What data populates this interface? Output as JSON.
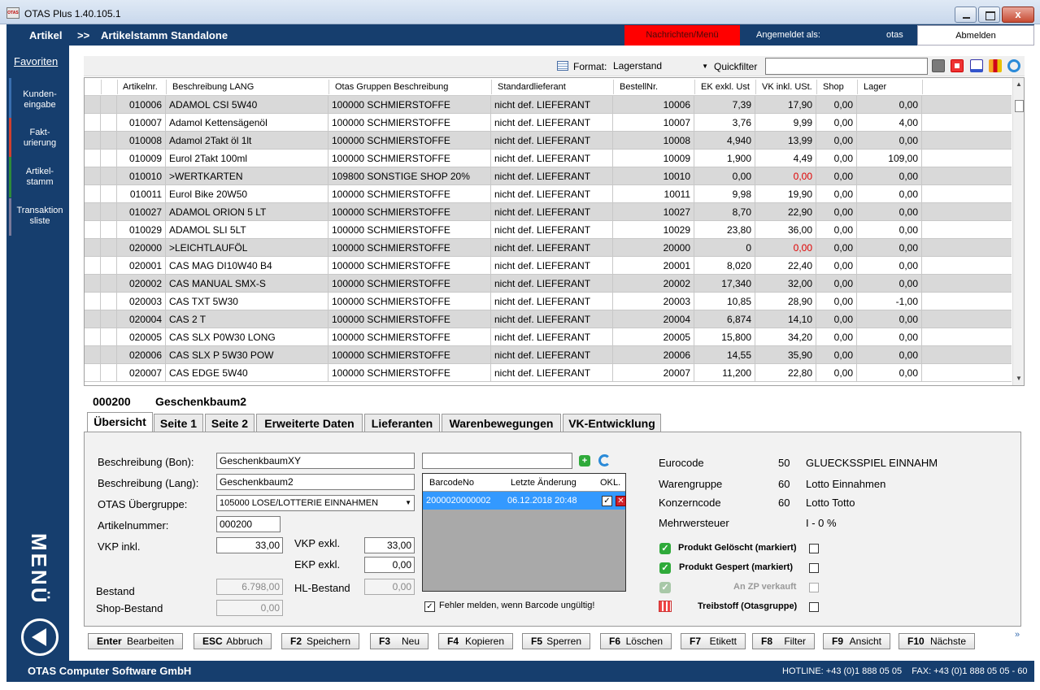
{
  "window": {
    "title": "OTAS Plus 1.40.105.1",
    "close_label": "x"
  },
  "header": {
    "section": "Artikel",
    "separator": ">>",
    "subtitle": "Artikelstamm Standalone",
    "messages": "Nachrichten/Menü",
    "logged_in_label": "Angemeldet als:",
    "user": "otas",
    "logout": "Abmelden"
  },
  "sidebar": {
    "favorites": "Favoriten",
    "items": [
      {
        "label": "Kunden-\neingabe",
        "color": "#3a6fb0"
      },
      {
        "label": "Fakt-\nurierung",
        "color": "#d04030"
      },
      {
        "label": "Artikel-\nstamm",
        "color": "#2e8b3a"
      },
      {
        "label": "Transaktion\nsliste",
        "color": "#7a7a9a"
      }
    ],
    "menu_label": "MENÜ"
  },
  "toolbar": {
    "format_label": "Format:",
    "format_value": "Lagerstand",
    "quickfilter_label": "Quickfilter",
    "quickfilter_value": ""
  },
  "grid": {
    "columns": [
      "Artikelnr.",
      "Beschreibung LANG",
      "Otas Gruppen Beschreibung",
      "Standardlieferant",
      "BestellNr.",
      "EK exkl. Ust",
      "VK inkl. USt.",
      "Shop",
      "Lager"
    ],
    "rows": [
      [
        "010006",
        "ADAMOL CSI  5W40",
        "100000 SCHMIERSTOFFE",
        "nicht def. LIEFERANT",
        "10006",
        "7,39",
        "17,90",
        "0,00",
        "0,00"
      ],
      [
        "010007",
        "Adamol Kettensägenöl",
        "100000 SCHMIERSTOFFE",
        "nicht def. LIEFERANT",
        "10007",
        "3,76",
        "9,99",
        "0,00",
        "4,00"
      ],
      [
        "010008",
        "Adamol 2Takt öl 1lt",
        "100000 SCHMIERSTOFFE",
        "nicht def. LIEFERANT",
        "10008",
        "4,940",
        "13,99",
        "0,00",
        "0,00"
      ],
      [
        "010009",
        "Eurol 2Takt  100ml",
        "100000 SCHMIERSTOFFE",
        "nicht def. LIEFERANT",
        "10009",
        "1,900",
        "4,49",
        "0,00",
        "109,00"
      ],
      [
        "010010",
        ">WERTKARTEN",
        "109800 SONSTIGE SHOP 20%",
        "nicht def. LIEFERANT",
        "10010",
        "0,00",
        "0,00",
        "0,00",
        "0,00"
      ],
      [
        "010011",
        "Eurol Bike 20W50",
        "100000 SCHMIERSTOFFE",
        "nicht def. LIEFERANT",
        "10011",
        "9,98",
        "19,90",
        "0,00",
        "0,00"
      ],
      [
        "010027",
        "ADAMOL ORION 5 LT",
        "100000 SCHMIERSTOFFE",
        "nicht def. LIEFERANT",
        "10027",
        "8,70",
        "22,90",
        "0,00",
        "0,00"
      ],
      [
        "010029",
        "ADAMOL SLI  5LT",
        "100000 SCHMIERSTOFFE",
        "nicht def. LIEFERANT",
        "10029",
        "23,80",
        "36,00",
        "0,00",
        "0,00"
      ],
      [
        "020000",
        ">LEICHTLAUFÖL",
        "100000 SCHMIERSTOFFE",
        "nicht def. LIEFERANT",
        "20000",
        "0",
        "0,00",
        "0,00",
        "0,00"
      ],
      [
        "020001",
        "CAS MAG DI10W40 B4",
        "100000 SCHMIERSTOFFE",
        "nicht def. LIEFERANT",
        "20001",
        "8,020",
        "22,40",
        "0,00",
        "0,00"
      ],
      [
        "020002",
        "CAS MANUAL SMX-S",
        "100000 SCHMIERSTOFFE",
        "nicht def. LIEFERANT",
        "20002",
        "17,340",
        "32,00",
        "0,00",
        "0,00"
      ],
      [
        "020003",
        "CAS TXT 5W30",
        "100000 SCHMIERSTOFFE",
        "nicht def. LIEFERANT",
        "20003",
        "10,85",
        "28,90",
        "0,00",
        "-1,00"
      ],
      [
        "020004",
        "CAS 2 T",
        "100000 SCHMIERSTOFFE",
        "nicht def. LIEFERANT",
        "20004",
        "6,874",
        "14,10",
        "0,00",
        "0,00"
      ],
      [
        "020005",
        "CAS SLX P0W30 LONG",
        "100000 SCHMIERSTOFFE",
        "nicht def. LIEFERANT",
        "20005",
        "15,800",
        "34,20",
        "0,00",
        "0,00"
      ],
      [
        "020006",
        "CAS SLX P 5W30 POW",
        "100000 SCHMIERSTOFFE",
        "nicht def. LIEFERANT",
        "20006",
        "14,55",
        "35,90",
        "0,00",
        "0,00"
      ],
      [
        "020007",
        "CAS EDGE   5W40",
        "100000 SCHMIERSTOFFE",
        "nicht def. LIEFERANT",
        "20007",
        "11,200",
        "22,80",
        "0,00",
        "0,00"
      ]
    ],
    "red_vk_rows": [
      4,
      8
    ]
  },
  "detail": {
    "code": "000200",
    "name": "Geschenkbaum2",
    "tabs": [
      "Übersicht",
      "Seite 1",
      "Seite 2",
      "Erweiterte Daten",
      "Lieferanten",
      "Warenbewegungen",
      "VK-Entwicklung"
    ],
    "fields": {
      "beschreibung_bon_label": "Beschreibung (Bon):",
      "beschreibung_bon": "GeschenkbaumXY",
      "beschreibung_lang_label": "Beschreibung (Lang):",
      "beschreibung_lang": "Geschenkbaum2",
      "uebergruppe_label": "OTAS Übergruppe:",
      "uebergruppe": "105000 LOSE/LOTTERIE EINNAHMEN",
      "artikelnummer_label": "Artikelnummer:",
      "artikelnummer": "000200",
      "vkp_inkl_label": "VKP inkl.",
      "vkp_inkl": "33,00",
      "vkp_exkl_label": "VKP exkl.",
      "vkp_exkl": "33,00",
      "ekp_exkl_label": "EKP exkl.",
      "ekp_exkl": "0,00",
      "bestand_label": "Bestand",
      "bestand": "6.798,00",
      "shop_bestand_label": "Shop-Bestand",
      "shop_bestand": "0,00",
      "hl_bestand_label": "HL-Bestand",
      "hl_bestand": "0,00"
    },
    "barcode": {
      "input": "",
      "headers": [
        "BarcodeNo",
        "Letzte Änderung",
        "OK",
        "L."
      ],
      "row": {
        "barcode": "2000020000002",
        "changed": "06.12.2018 20:48"
      },
      "error_check_label": "Fehler melden, wenn Barcode ungültig!"
    },
    "info": {
      "eurocode_label": "Eurocode",
      "eurocode_num": "50",
      "eurocode_text": "GLUECKSSPIEL EINNAHM",
      "warengruppe_label": "Warengruppe",
      "warengruppe_num": "60",
      "warengruppe_text": "Lotto Einnahmen",
      "konzerncode_label": "Konzerncode",
      "konzerncode_num": "60",
      "konzerncode_text": "Lotto Totto",
      "mwst_label": "Mehrwersteuer",
      "mwst_text": "I - 0 %"
    },
    "flags": {
      "geloescht": "Produkt Gelöscht (markiert)",
      "gesperrt": "Produkt Gespert (markiert)",
      "zp": "An ZP verkauft",
      "treibstoff": "Treibstoff (Otasgruppe)"
    }
  },
  "function_keys": [
    {
      "key": "Enter",
      "label": "Bearbeiten"
    },
    {
      "key": "ESC",
      "label": "Abbruch"
    },
    {
      "key": "F2",
      "label": "Speichern"
    },
    {
      "key": "F3",
      "label": "Neu"
    },
    {
      "key": "F4",
      "label": "Kopieren"
    },
    {
      "key": "F5",
      "label": "Sperren"
    },
    {
      "key": "F6",
      "label": "Löschen"
    },
    {
      "key": "F7",
      "label": "Etikett"
    },
    {
      "key": "F8",
      "label": "Filter"
    },
    {
      "key": "F9",
      "label": "Ansicht"
    },
    {
      "key": "F10",
      "label": "Nächste"
    }
  ],
  "footer": {
    "company": "OTAS Computer Software GmbH",
    "contact": "HOTLINE: +43 (0)1 888 05 05    FAX: +43 (0)1 888 05 05 - 60"
  }
}
